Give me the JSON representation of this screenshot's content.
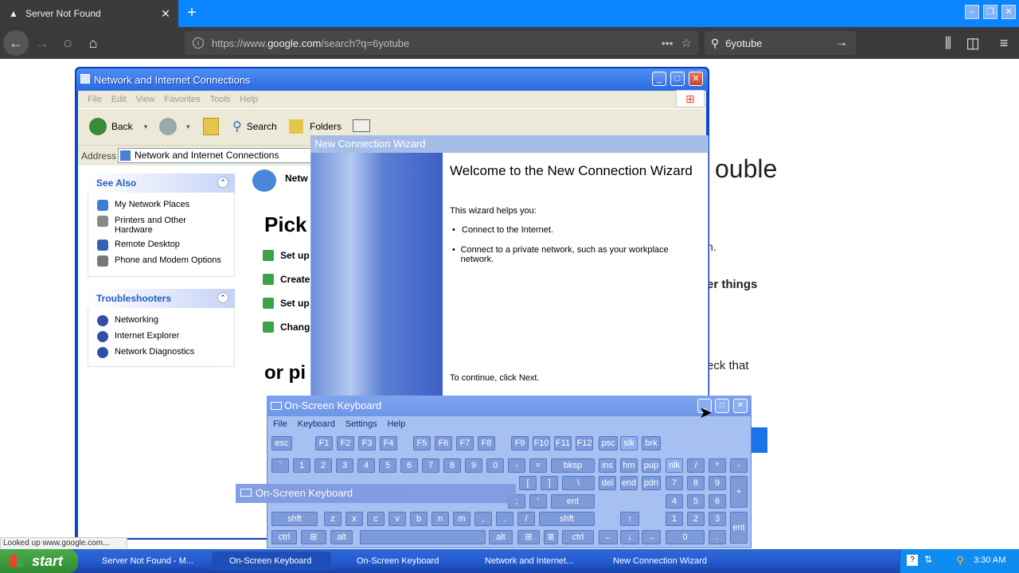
{
  "browser": {
    "tab_title": "Server Not Found",
    "tab_close": "✕",
    "new_tab": "+",
    "url_prefix": "https://www.",
    "url_domain": "google.com",
    "url_path": "/search?q=6yotube",
    "search_value": "6yotube",
    "status_text": "Looked up www.google.com..."
  },
  "page_bg": {
    "fragment_ouble": "ouble",
    "fragment_n": "n.",
    "fragment_er_things": "er things",
    "fragment_eck_that": "eck that"
  },
  "xp_window": {
    "title": "Network and Internet Connections",
    "menu": [
      "File",
      "Edit",
      "View",
      "Favorites",
      "Tools",
      "Help"
    ],
    "toolbar": {
      "back": "Back",
      "search": "Search",
      "folders": "Folders"
    },
    "address_label": "Address",
    "address_value": "Network and Internet Connections",
    "see_also": {
      "heading": "See Also",
      "items": [
        "My Network Places",
        "Printers and Other Hardware",
        "Remote Desktop",
        "Phone and Modem Options"
      ]
    },
    "troubleshooters": {
      "heading": "Troubleshooters",
      "items": [
        "Networking",
        "Internet Explorer",
        "Network Diagnostics"
      ]
    },
    "content": {
      "netw": "Netw",
      "pick": "Pick",
      "items": [
        "Set up",
        "Create",
        "Set up",
        "Change"
      ],
      "or_pi": "or pi"
    }
  },
  "wizard": {
    "title": "New Connection Wizard",
    "heading": "Welcome to the New Connection Wizard",
    "intro": "This wizard helps you:",
    "bullets": [
      "Connect to the Internet.",
      "Connect to a private network, such as your workplace network."
    ],
    "continue": "To continue, click Next."
  },
  "osk": {
    "title": "On-Screen Keyboard",
    "menu": [
      "File",
      "Keyboard",
      "Settings",
      "Help"
    ],
    "tooltip": "On-Screen Keyboard"
  },
  "taskbar": {
    "start": "start",
    "items": [
      "Server Not Found - M...",
      "On-Screen Keyboard",
      "On-Screen Keyboard",
      "Network and Internet...",
      "New Connection Wizard"
    ],
    "clock": "3:30 AM"
  }
}
